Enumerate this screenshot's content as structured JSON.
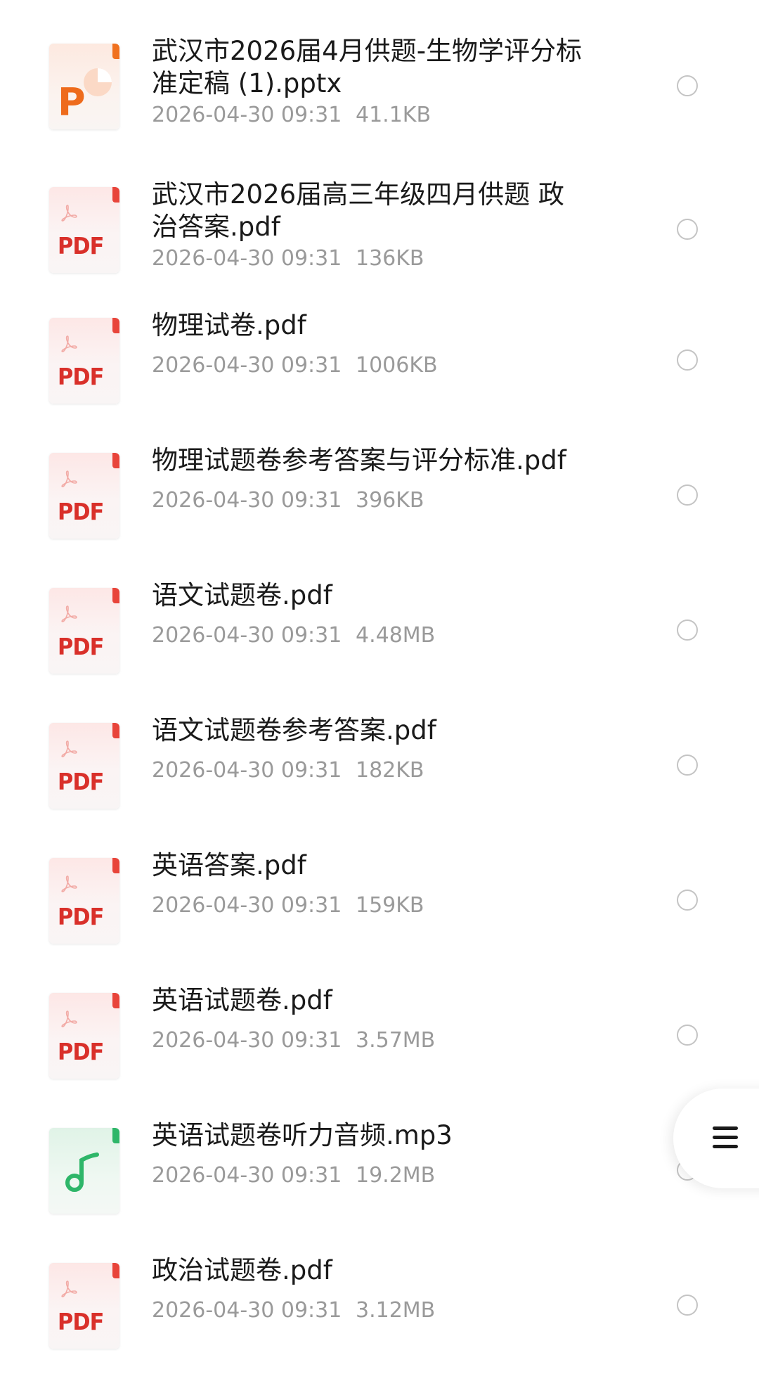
{
  "files": [
    {
      "type": "ppt",
      "icon": "ppt-file-icon",
      "name_lines": [
        "武汉市2026届4月供题-生物学评分标",
        "准定稿 (1).pptx"
      ],
      "date": "2026-04-30 09:31",
      "size": "41.1KB"
    },
    {
      "type": "pdf",
      "icon": "pdf-file-icon",
      "name_lines": [
        "武汉市2026届高三年级四月供题 政",
        "治答案.pdf"
      ],
      "date": "2026-04-30 09:31",
      "size": "136KB"
    },
    {
      "type": "pdf",
      "icon": "pdf-file-icon",
      "name_lines": [
        "物理试卷.pdf"
      ],
      "date": "2026-04-30 09:31",
      "size": "1006KB"
    },
    {
      "type": "pdf",
      "icon": "pdf-file-icon",
      "name_lines": [
        "物理试题卷参考答案与评分标准.pdf"
      ],
      "date": "2026-04-30 09:31",
      "size": "396KB"
    },
    {
      "type": "pdf",
      "icon": "pdf-file-icon",
      "name_lines": [
        "语文试题卷.pdf"
      ],
      "date": "2026-04-30 09:31",
      "size": "4.48MB"
    },
    {
      "type": "pdf",
      "icon": "pdf-file-icon",
      "name_lines": [
        "语文试题卷参考答案.pdf"
      ],
      "date": "2026-04-30 09:31",
      "size": "182KB"
    },
    {
      "type": "pdf",
      "icon": "pdf-file-icon",
      "name_lines": [
        "英语答案.pdf"
      ],
      "date": "2026-04-30 09:31",
      "size": "159KB"
    },
    {
      "type": "pdf",
      "icon": "pdf-file-icon",
      "name_lines": [
        "英语试题卷.pdf"
      ],
      "date": "2026-04-30 09:31",
      "size": "3.57MB"
    },
    {
      "type": "audio",
      "icon": "audio-file-icon",
      "name_lines": [
        "英语试题卷听力音频.mp3"
      ],
      "date": "2026-04-30 09:31",
      "size": "19.2MB"
    },
    {
      "type": "pdf",
      "icon": "pdf-file-icon",
      "name_lines": [
        "政治试题卷.pdf"
      ],
      "date": "2026-04-30 09:31",
      "size": "3.12MB"
    }
  ],
  "icon_labels": {
    "pdf": "PDF",
    "ppt": "P"
  },
  "floating_menu": {
    "icon": "menu-icon"
  },
  "colors": {
    "pdf_accent": "#e8443a",
    "ppt_accent": "#f0711f",
    "audio_accent": "#2eb669",
    "name_text": "#1a1a1a",
    "meta_text": "#9a9a9a",
    "radio_border": "#c4c4c4"
  }
}
